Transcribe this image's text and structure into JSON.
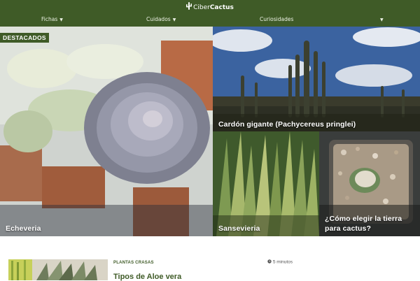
{
  "header": {
    "brand_light": "Ciber",
    "brand_bold": "Cactus",
    "nav": [
      {
        "label": "Fichas",
        "caret": "▼"
      },
      {
        "label": "Cuidados",
        "caret": "▼"
      },
      {
        "label": "Curiosidades",
        "caret": ""
      },
      {
        "label": "",
        "caret": "▼"
      }
    ]
  },
  "featured": {
    "badge": "DESTACADOS",
    "tiles": [
      {
        "title": "Echeveria"
      },
      {
        "title": "Cardón gigante (Pachycereus pringlei)"
      },
      {
        "title": "Sansevieria"
      },
      {
        "title": "¿Cómo elegir la tierra para cactus?"
      }
    ]
  },
  "article": {
    "category": "PLANTAS CRASAS",
    "read_time": "5 minutos",
    "title": "Tipos de Aloe vera"
  },
  "colors": {
    "brand": "#3f5b27",
    "white": "#ffffff"
  }
}
